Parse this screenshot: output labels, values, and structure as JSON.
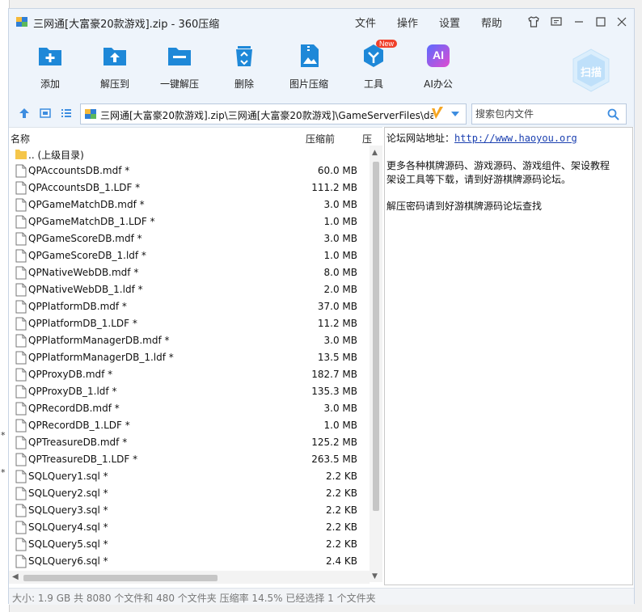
{
  "window": {
    "title": "三网通[大富豪20款游戏].zip - 360压缩",
    "menu": [
      "文件",
      "操作",
      "设置",
      "帮助"
    ]
  },
  "toolbar": {
    "add": "添加",
    "extract_to": "解压到",
    "one_click_extract": "一键解压",
    "delete": "删除",
    "image_compress": "图片压缩",
    "tools": "工具",
    "tools_badge": "New",
    "ai_office": "AI办公",
    "ai_icon_text": "AI",
    "scan": "扫描"
  },
  "address": {
    "path": "三网通[大富豪20款游戏].zip\\三网通[大富豪20款游戏]\\GameServerFiles\\da"
  },
  "search": {
    "placeholder": "搜索包内文件"
  },
  "list": {
    "col_name": "名称",
    "col_size": "压缩前",
    "col_extra": "压",
    "parent": ".. (上级目录)",
    "files": [
      {
        "name": "QPAccountsDB.mdf *",
        "size": "60.0 MB"
      },
      {
        "name": "QPAccountsDB_1.LDF *",
        "size": "111.2 MB"
      },
      {
        "name": "QPGameMatchDB.mdf *",
        "size": "3.0 MB"
      },
      {
        "name": "QPGameMatchDB_1.LDF *",
        "size": "1.0 MB"
      },
      {
        "name": "QPGameScoreDB.mdf *",
        "size": "3.0 MB"
      },
      {
        "name": "QPGameScoreDB_1.ldf *",
        "size": "1.0 MB"
      },
      {
        "name": "QPNativeWebDB.mdf *",
        "size": "8.0 MB"
      },
      {
        "name": "QPNativeWebDB_1.ldf *",
        "size": "2.0 MB"
      },
      {
        "name": "QPPlatformDB.mdf *",
        "size": "37.0 MB"
      },
      {
        "name": "QPPlatformDB_1.LDF *",
        "size": "11.2 MB"
      },
      {
        "name": "QPPlatformManagerDB.mdf *",
        "size": "3.0 MB"
      },
      {
        "name": "QPPlatformManagerDB_1.ldf *",
        "size": "13.5 MB"
      },
      {
        "name": "QPProxyDB.mdf *",
        "size": "182.7 MB"
      },
      {
        "name": "QPProxyDB_1.ldf *",
        "size": "135.3 MB"
      },
      {
        "name": "QPRecordDB.mdf *",
        "size": "3.0 MB"
      },
      {
        "name": "QPRecordDB_1.LDF *",
        "size": "1.0 MB"
      },
      {
        "name": "QPTreasureDB.mdf *",
        "size": "125.2 MB"
      },
      {
        "name": "QPTreasureDB_1.LDF *",
        "size": "263.5 MB"
      },
      {
        "name": "SQLQuery1.sql *",
        "size": "2.2 KB"
      },
      {
        "name": "SQLQuery2.sql *",
        "size": "2.2 KB"
      },
      {
        "name": "SQLQuery3.sql *",
        "size": "2.2 KB"
      },
      {
        "name": "SQLQuery4.sql *",
        "size": "2.2 KB"
      },
      {
        "name": "SQLQuery5.sql *",
        "size": "2.2 KB"
      },
      {
        "name": "SQLQuery6.sql *",
        "size": "2.4 KB"
      }
    ]
  },
  "preview": {
    "line1_label": "论坛网站地址：",
    "line1_link": "http://www.haoyou.org",
    "line2": "更多各种棋牌源码、游戏源码、游戏组件、架设教程",
    "line3": "架设工具等下载，请到好游棋牌源码论坛。",
    "line4": "解压密码请到好游棋牌源码论坛查找"
  },
  "status": {
    "text": "大小: 1.9 GB 共 8080 个文件和 480 个文件夹 压缩率 14.5% 已经选择 1 个文件夹"
  },
  "colors": {
    "accent": "#1e88d8",
    "chrome": "#eef4fb",
    "new_badge": "#f0402a",
    "folder": "#f5c64a"
  }
}
